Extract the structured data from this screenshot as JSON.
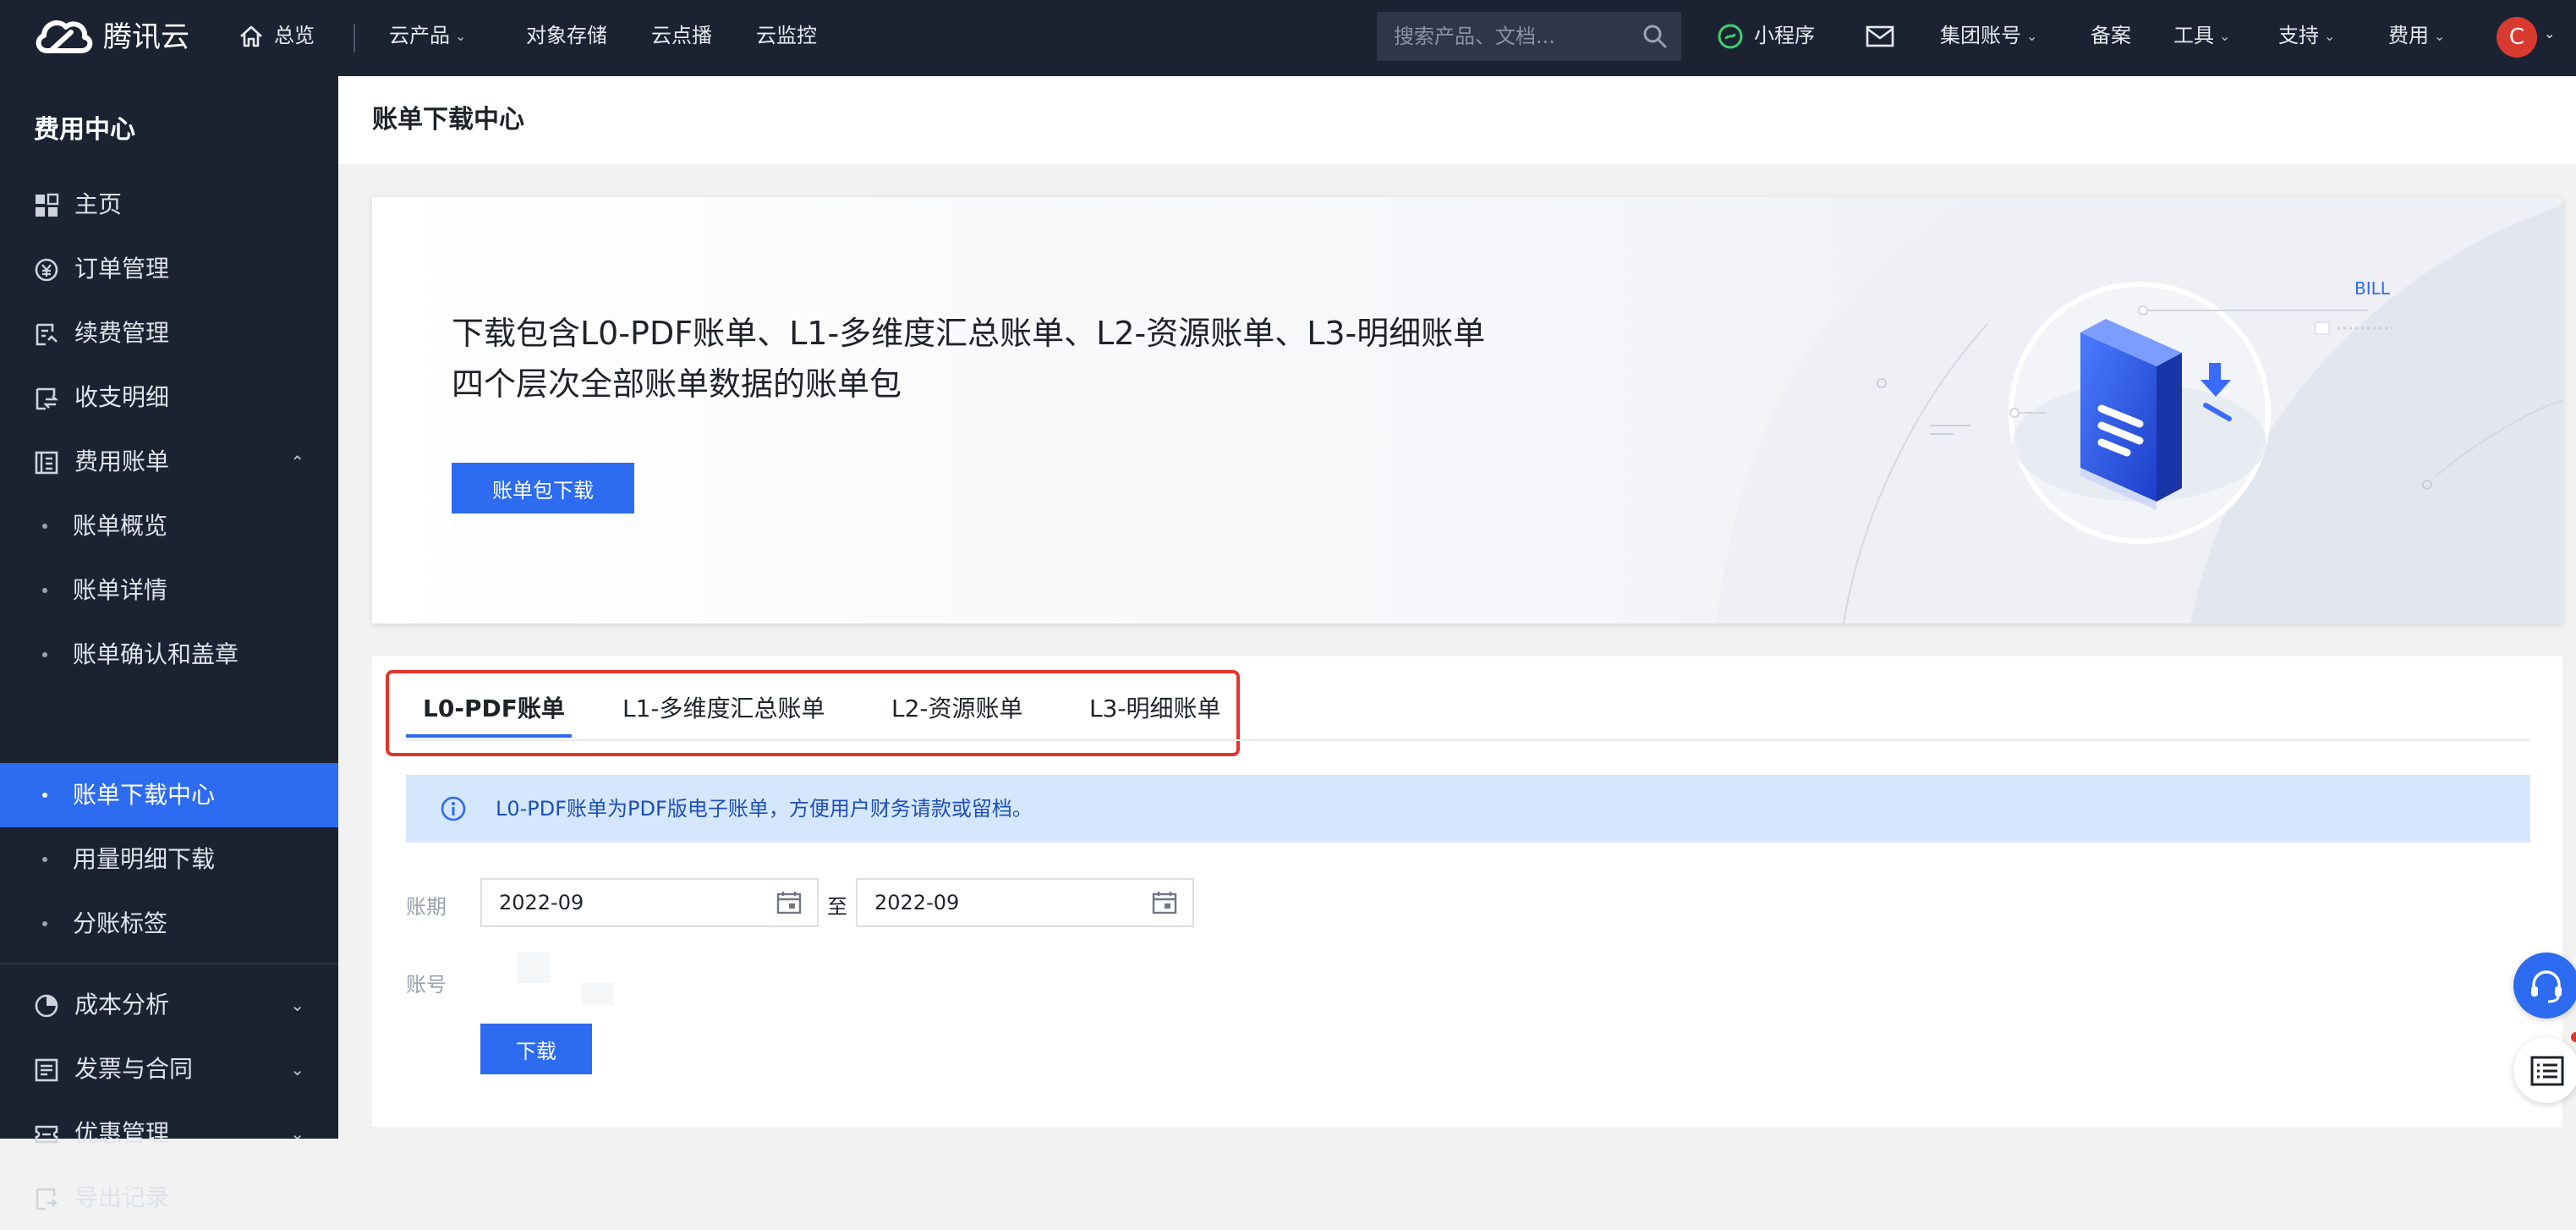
{
  "topbar": {
    "brand": "腾讯云",
    "nav": [
      {
        "label": "总览"
      },
      {
        "label": "云产品"
      },
      {
        "label": "对象存储"
      },
      {
        "label": "云点播"
      },
      {
        "label": "云监控"
      }
    ],
    "search_placeholder": "搜索产品、文档...",
    "right": [
      {
        "label": "小程序"
      },
      {
        "label": "集团账号"
      },
      {
        "label": "备案"
      },
      {
        "label": "工具"
      },
      {
        "label": "支持"
      },
      {
        "label": "费用"
      }
    ],
    "avatar": "C"
  },
  "sidebar": {
    "title": "费用中心",
    "items": [
      {
        "label": "主页"
      },
      {
        "label": "订单管理"
      },
      {
        "label": "续费管理"
      },
      {
        "label": "收支明细"
      },
      {
        "label": "费用账单"
      },
      {
        "label": "账单概览"
      },
      {
        "label": "账单详情"
      },
      {
        "label": "账单确认和盖章"
      },
      {
        "label": "账单下载中心"
      },
      {
        "label": "用量明细下载"
      },
      {
        "label": "分账标签"
      },
      {
        "label": "成本分析"
      },
      {
        "label": "发票与合同"
      },
      {
        "label": "优惠管理"
      },
      {
        "label": "导出记录"
      }
    ]
  },
  "page": {
    "title": "账单下载中心"
  },
  "banner": {
    "line1": "下载包含L0-PDF账单、L1-多维度汇总账单、L2-资源账单、L3-明细账单",
    "line2": "四个层次全部账单数据的账单包",
    "button": "账单包下载",
    "art_label": "BILL"
  },
  "tabs": [
    {
      "label": "L0-PDF账单",
      "active": true
    },
    {
      "label": "L1-多维度汇总账单"
    },
    {
      "label": "L2-资源账单"
    },
    {
      "label": "L3-明细账单"
    }
  ],
  "info": "L0-PDF账单为PDF版电子账单，方便用户财务请款或留档。",
  "form": {
    "period_label": "账期",
    "from": "2022-09",
    "to_sep": "至",
    "to": "2022-09",
    "account_label": "账号",
    "download": "下载"
  },
  "colors": {
    "topbar": "#1b2333",
    "accent": "#2d6bf0",
    "info_bg": "#d5e7ff",
    "highlight": "#e2342b"
  }
}
